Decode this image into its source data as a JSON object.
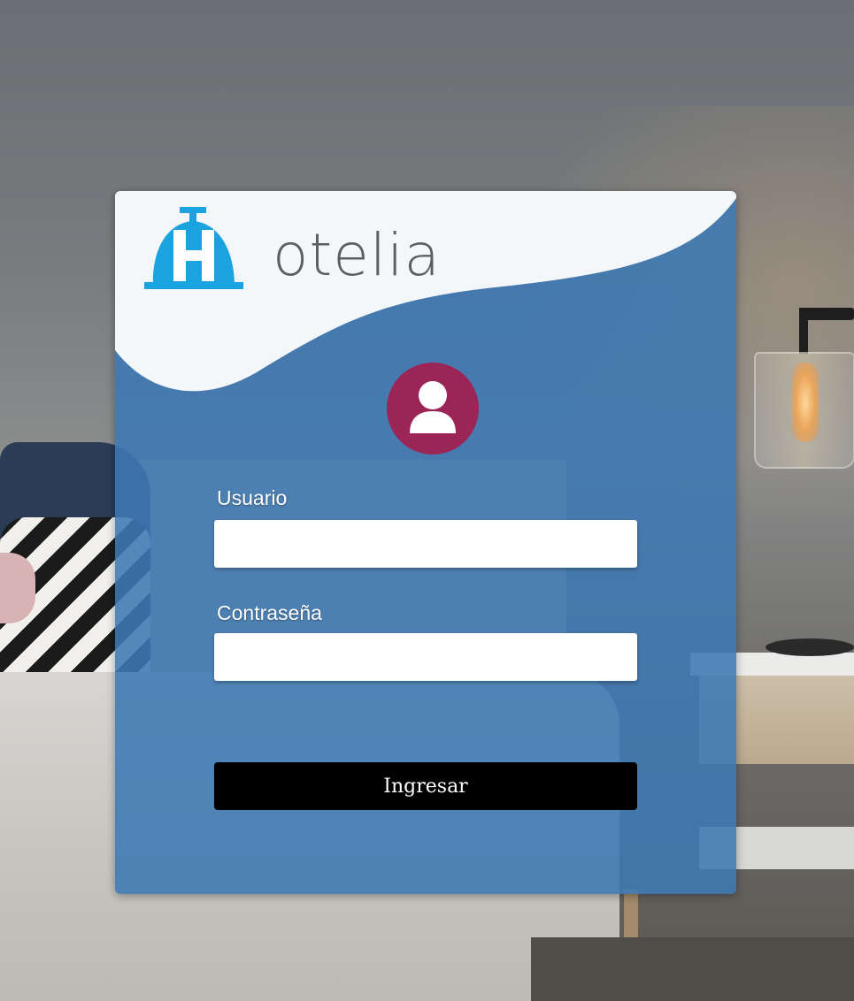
{
  "brand": {
    "name_rest": "otelia",
    "logo_icon": "hotel-bell-h-icon",
    "colors": {
      "logo_blue": "#1aa3df",
      "logo_gray": "#5b5f64"
    }
  },
  "card": {
    "background": "#3e79b4",
    "wave_color": "#f4f7fa",
    "avatar_icon": "user-icon",
    "avatar_color": "#9b2556"
  },
  "form": {
    "username_label": "Usuario",
    "username_value": "",
    "password_label": "Contraseña",
    "password_value": "",
    "submit_label": "Ingresar",
    "submit_color": "#000000"
  }
}
